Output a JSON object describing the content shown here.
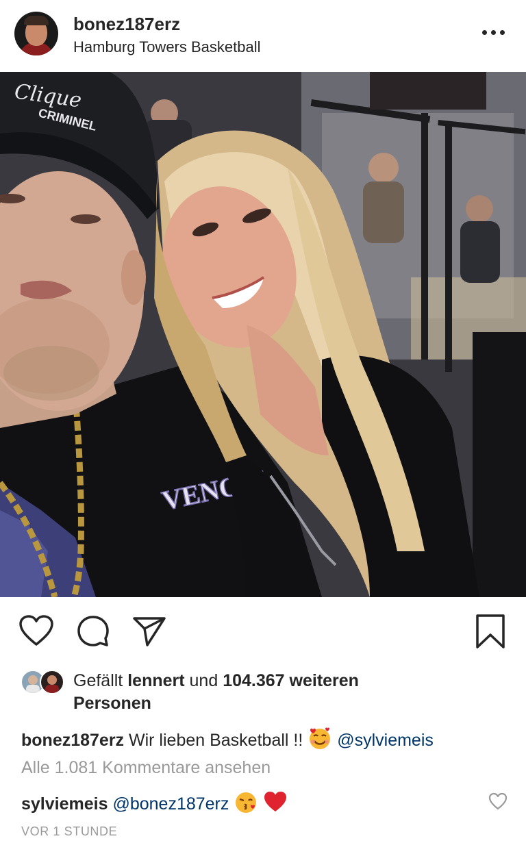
{
  "post": {
    "username": "bonez187erz",
    "location": "Hamburg Towers Basketball"
  },
  "header_icons": {
    "avatar": "user-avatar",
    "more": "more-options-icon"
  },
  "photo": {
    "jacket_text": "VENOM",
    "cap_text": "CRIMINEL",
    "cap_script": "Clique"
  },
  "actions": {
    "like": "heart-outline-icon",
    "comment": "comment-bubble-icon",
    "share": "paper-plane-icon",
    "save": "bookmark-icon"
  },
  "likes": {
    "prefix": "Gefällt",
    "user": "lennert",
    "middle": "und",
    "count": "104.367 weiteren",
    "suffix": "Personen"
  },
  "caption": {
    "username": "bonez187erz",
    "text": "Wir lieben Basketball !!",
    "emoji": "smiling-face-with-hearts-emoji",
    "mention": "@sylviemeis"
  },
  "view_comments": "Alle 1.081 Kommentare ansehen",
  "comment": {
    "username": "sylviemeis",
    "mention": "@bonez187erz",
    "emojis": [
      "kissing-face-emoji",
      "red-heart-emoji"
    ]
  },
  "timestamp": "VOR 1 STUNDE",
  "colors": {
    "text": "#262626",
    "secondary": "#999999",
    "mention": "#003569",
    "heart_red": "#e0242f"
  }
}
